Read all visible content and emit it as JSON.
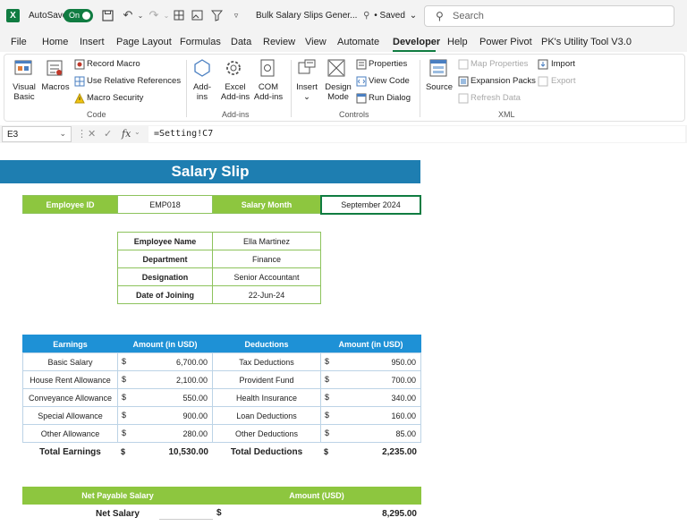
{
  "titlebar": {
    "autosave_label": "AutoSave",
    "autosave_state": "On",
    "doc_title": "Bulk Salary Slips Gener...",
    "saved_status": "• Saved",
    "search_placeholder": "Search"
  },
  "menu": {
    "tabs": [
      "File",
      "Home",
      "Insert",
      "Page Layout",
      "Formulas",
      "Data",
      "Review",
      "View",
      "Automate",
      "Developer",
      "Help",
      "Power Pivot",
      "PK's Utility Tool V3.0"
    ],
    "active": "Developer"
  },
  "ribbon": {
    "code": {
      "visual_basic": [
        "Visual",
        "Basic"
      ],
      "macros": "Macros",
      "record_macro": "Record Macro",
      "use_relative": "Use Relative References",
      "macro_security": "Macro Security",
      "label": "Code"
    },
    "addins": {
      "addins": [
        "Add-",
        "ins"
      ],
      "excel_addins": [
        "Excel",
        "Add-ins"
      ],
      "com_addins": [
        "COM",
        "Add-ins"
      ],
      "label": "Add-ins"
    },
    "controls": {
      "insert": "Insert",
      "design_mode": [
        "Design",
        "Mode"
      ],
      "properties": "Properties",
      "view_code": "View Code",
      "run_dialog": "Run Dialog",
      "label": "Controls"
    },
    "xml": {
      "source": "Source",
      "map_properties": "Map Properties",
      "expansion_packs": "Expansion Packs",
      "refresh_data": "Refresh Data",
      "import": "Import",
      "export": "Export",
      "label": "XML"
    }
  },
  "formula_bar": {
    "cell_ref": "E3",
    "fx": "fx",
    "formula": "=Setting!C7"
  },
  "slip": {
    "title": "Salary Slip",
    "employee_id_label": "Employee ID",
    "employee_id": "EMP018",
    "salary_month_label": "Salary Month",
    "salary_month": "September 2024",
    "details": [
      {
        "label": "Employee Name",
        "value": "Ella Martinez"
      },
      {
        "label": "Department",
        "value": "Finance"
      },
      {
        "label": "Designation",
        "value": "Senior Accountant"
      },
      {
        "label": "Date of Joining",
        "value": "22-Jun-24"
      }
    ],
    "table_headers": [
      "Earnings",
      "Amount (in USD)",
      "Deductions",
      "Amount (in USD)"
    ],
    "currency": "$",
    "rows": [
      {
        "earning": "Basic Salary",
        "earning_amt": "6,700.00",
        "deduction": "Tax Deductions",
        "deduction_amt": "950.00"
      },
      {
        "earning": "House Rent Allowance",
        "earning_amt": "2,100.00",
        "deduction": "Provident Fund",
        "deduction_amt": "700.00"
      },
      {
        "earning": "Conveyance Allowance",
        "earning_amt": "550.00",
        "deduction": "Health Insurance",
        "deduction_amt": "340.00"
      },
      {
        "earning": "Special Allowance",
        "earning_amt": "900.00",
        "deduction": "Loan Deductions",
        "deduction_amt": "160.00"
      },
      {
        "earning": "Other Allowance",
        "earning_amt": "280.00",
        "deduction": "Other Deductions",
        "deduction_amt": "85.00"
      }
    ],
    "total_earnings_label": "Total Earnings",
    "total_earnings": "10,530.00",
    "total_deductions_label": "Total Deductions",
    "total_deductions": "2,235.00",
    "net_header_label": "Net Payable Salary",
    "net_header_amount": "Amount (USD)",
    "net_label": "Net Salary",
    "net_amount": "8,295.00"
  },
  "colors": {
    "excel_green": "#107c41",
    "banner_blue": "#1e7eb1",
    "header_blue": "#1e91d6",
    "accent_green": "#8dc63f"
  }
}
